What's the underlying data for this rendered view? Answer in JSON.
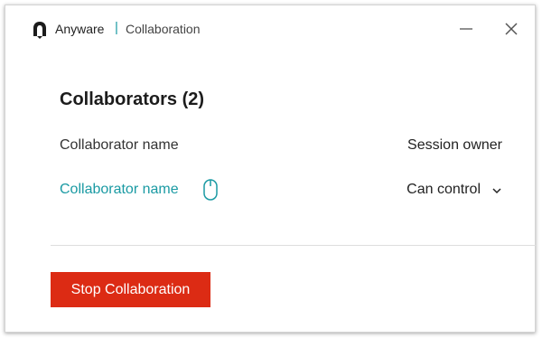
{
  "titlebar": {
    "app_name": "Anyware",
    "separator": "|",
    "window_title": "Collaboration",
    "logo_icon": "anyware-logo-icon",
    "minimize_icon": "minimize-icon",
    "close_icon": "close-icon"
  },
  "main": {
    "heading": "Collaborators (2)",
    "collaborators": [
      {
        "name": "Collaborator name",
        "role": "Session owner",
        "is_link": false
      },
      {
        "name": "Collaborator name",
        "role": "Can control",
        "is_link": true,
        "icon": "mouse-icon",
        "role_control": "dropdown",
        "dropdown_icon": "chevron-down-icon"
      }
    ],
    "stop_button_label": "Stop Collaboration"
  },
  "colors": {
    "accent": "#1a9aa3",
    "danger": "#dc2b14",
    "text": "#222222"
  }
}
